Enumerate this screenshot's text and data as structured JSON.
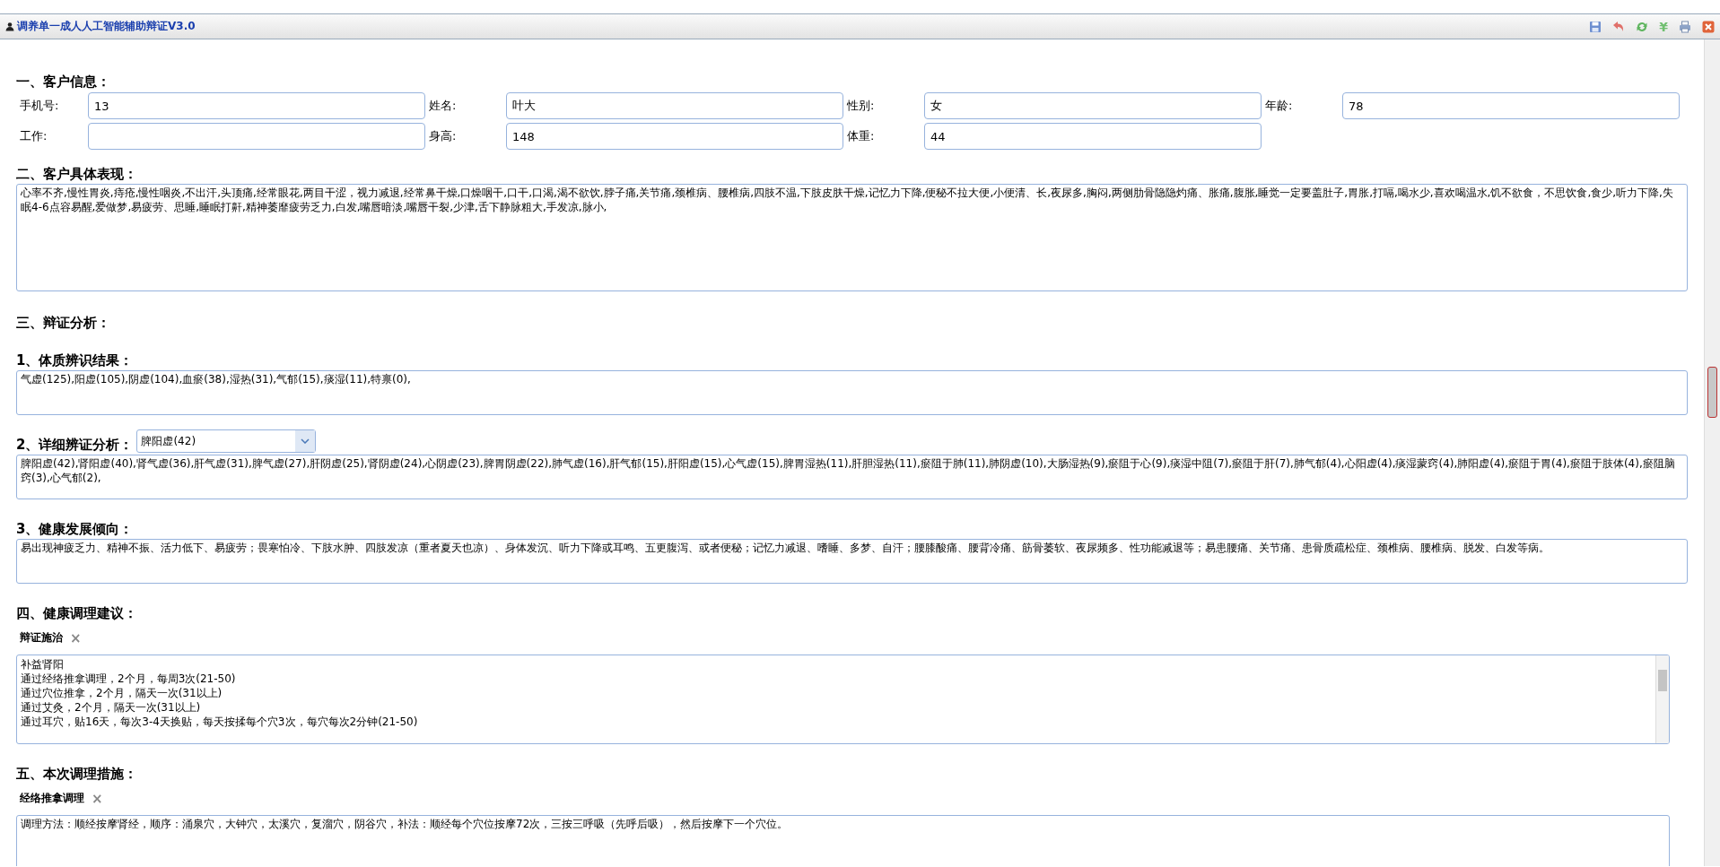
{
  "window": {
    "title": "调养单一成人人工智能辅助辩证V3.0"
  },
  "toolbar": [
    {
      "kind": "save"
    },
    {
      "kind": "undo"
    },
    {
      "kind": "refresh"
    },
    {
      "kind": "yen",
      "glyph": "¥"
    },
    {
      "kind": "print"
    },
    {
      "kind": "close"
    }
  ],
  "customer": {
    "heading": "一、客户信息：",
    "fields": [
      {
        "label": "手机号:",
        "value": "13"
      },
      {
        "label": "姓名:",
        "value": "叶大"
      },
      {
        "label": "性别:",
        "value": "女"
      },
      {
        "label": "年龄:",
        "value": "78"
      },
      {
        "label": "工作:"
      },
      {
        "label": "身高:",
        "value": "148"
      },
      {
        "label": "体重:",
        "value": "44"
      }
    ]
  },
  "symptoms": {
    "heading": "二、客户具体表现：",
    "text": "心率不齐,慢性胃炎,痔疮,慢性咽炎,不出汗,头顶痛,经常眼花,两目干涩，视力减退,经常鼻干燥,口燥咽干,口干,口渴,渴不欲饮,脖子痛,关节痛,颈椎病、腰椎病,四肢不温,下肢皮肤干燥,记忆力下降,便秘不拉大便,小便清、长,夜尿多,胸闷,两侧肋骨隐隐灼痛、胀痛,腹胀,睡觉一定要盖肚子,胃胀,打嗝,喝水少,喜欢喝温水,饥不欲食，不思饮食,食少,听力下降,失眠4-6点容易醒,爱做梦,易疲劳、思睡,睡眠打鼾,精神萎靡疲劳乏力,白发,嘴唇暗淡,嘴唇干裂,少津,舌下静脉粗大,手发凉,脉小,"
  },
  "analysis": {
    "heading": "三、辩证分析：",
    "constitution": {
      "heading": "1、体质辨识结果：",
      "text": "气虚(125),阳虚(105),阴虚(104),血瘀(38),湿热(31),气郁(15),痰湿(11),特禀(0),"
    },
    "detail": {
      "heading": "2、详细辨证分析：",
      "select": "脾阳虚(42)",
      "text": "脾阳虚(42),肾阳虚(40),肾气虚(36),肝气虚(31),脾气虚(27),肝阴虚(25),肾阴虚(24),心阴虚(23),脾胃阴虚(22),肺气虚(16),肝气郁(15),肝阳虚(15),心气虚(15),脾胃湿热(11),肝胆湿热(11),瘀阻于肺(11),肺阴虚(10),大肠湿热(9),瘀阻于心(9),痰湿中阻(7),瘀阻于肝(7),肺气郁(4),心阳虚(4),痰湿蒙窍(4),肺阳虚(4),瘀阻于胃(4),瘀阻于肢体(4),瘀阻脑窍(3),心气郁(2),"
    },
    "trend": {
      "heading": "3、健康发展倾向：",
      "text": "易出现神疲乏力、精神不振、活力低下、易疲劳；畏寒怕冷、下肢水肿、四肢发凉（重者夏天也凉）、身体发沉、听力下降或耳鸣、五更腹泻、或者便秘；记忆力减退、嗜睡、多梦、自汗；腰膝酸痛、腰背冷痛、筋骨萎软、夜尿频多、性功能减退等；易患腰痛、关节痛、患骨质疏松症、颈椎病、腰椎病、脱发、白发等病。"
    }
  },
  "advice": {
    "heading": "四、健康调理建议：",
    "tab": "辩证施治",
    "close": "×",
    "lines": [
      "补益肾阳",
      "通过经络推拿调理，2个月，每周3次(21-50)",
      "通过穴位推拿，2个月，隔天一次(31以上)",
      "通过艾灸，2个月，隔天一次(31以上)",
      "通过耳穴，贴16天，每次3-4天换贴，每天按揉每个穴3次，每穴每次2分钟(21-50)"
    ]
  },
  "measures": {
    "heading": "五、本次调理措施：",
    "tab": "经络推拿调理",
    "close": "×",
    "text": "调理方法：顺经按摩肾经，顺序：涌泉穴，大钟穴，太溪穴，复溜穴，阴谷穴，补法：顺经每个穴位按摩72次，三按三呼吸（先呼后吸），然后按摩下一个穴位。"
  }
}
